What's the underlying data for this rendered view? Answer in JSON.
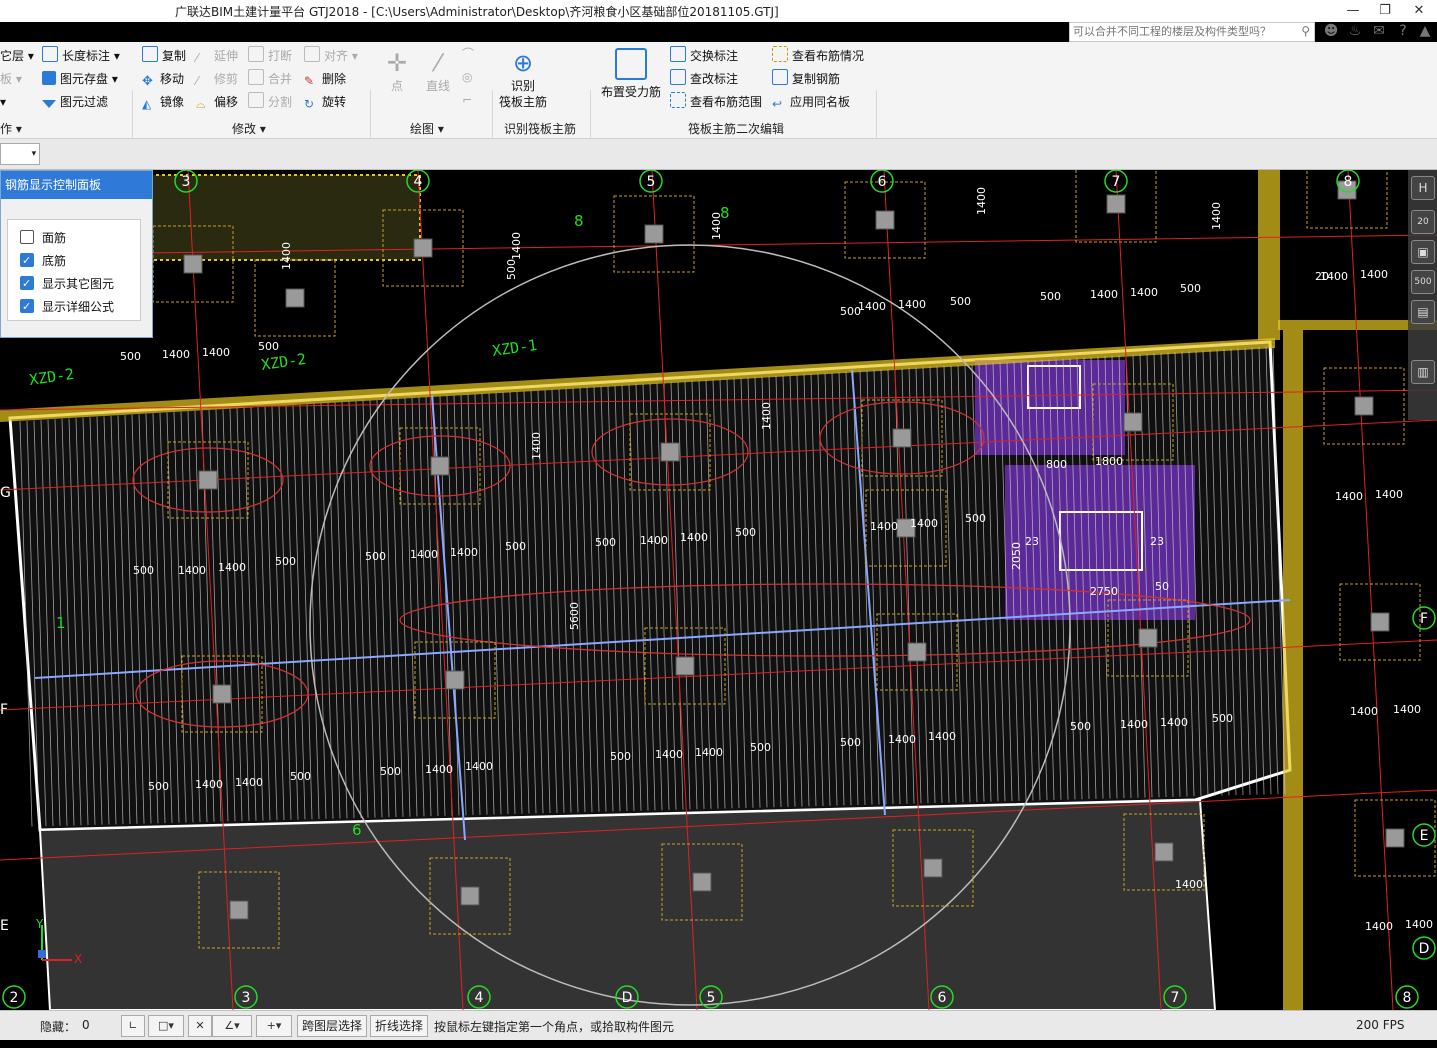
{
  "window": {
    "title": "广联达BIM土建计量平台 GTJ2018 - [C:\\Users\\Administrator\\Desktop\\齐河粮食小区基础部位20181105.GTJ]",
    "search_placeholder": "可以合并不同工程的楼层及构件类型吗？",
    "buttons": [
      "minimize",
      "restore",
      "close"
    ]
  },
  "ribbon": {
    "col1": [
      "它层",
      "板",
      "",
      "作"
    ],
    "col2": [
      "长度标注",
      "图元存盘",
      "图元过滤"
    ],
    "modify": [
      "复制",
      "移动",
      "镜像",
      "延伸",
      "修剪",
      "偏移",
      "打断",
      "合并",
      "分割",
      "对齐",
      "删除",
      "旋转"
    ],
    "modify_group": "修改",
    "draw": [
      "点",
      "直线"
    ],
    "draw_group": "绘图",
    "identify": {
      "line1": "识别",
      "line2": "筏板主筋",
      "group": "识别筏板主筋"
    },
    "edit_big": "布置受力筋",
    "edit": [
      "交换标注",
      "查改标注",
      "查看布筋范围",
      "查看布筋情况",
      "复制钢筋",
      "应用同名板"
    ],
    "edit_group": "筏板主筋二次编辑"
  },
  "panel": {
    "title": "钢筋显示控制面板",
    "options": [
      {
        "label": "面筋",
        "checked": false
      },
      {
        "label": "底筋",
        "checked": true
      },
      {
        "label": "显示其它图元",
        "checked": true
      },
      {
        "label": "显示详细公式",
        "checked": true
      }
    ]
  },
  "drawing": {
    "col_axes": [
      "3",
      "4",
      "5",
      "6",
      "7",
      "8"
    ],
    "bottom_axes": [
      "2",
      "3",
      "4",
      "D",
      "5",
      "6",
      "7",
      "8"
    ],
    "row_axes_left": [
      "G",
      "F",
      "E"
    ],
    "row_axes_right": [
      "F",
      "E",
      "D"
    ],
    "beam_labels": [
      "XZD-2",
      "XZD-2",
      "XZD-1"
    ],
    "dims": [
      "500",
      "1400",
      "1400",
      "500",
      "5600",
      "1800",
      "800",
      "2750",
      "2050",
      "50",
      "23",
      "23",
      "20"
    ],
    "grid_numbers": [
      "8",
      "8",
      "1",
      "6"
    ]
  },
  "navbar": [
    "H",
    "20",
    "500"
  ],
  "status": {
    "hidden_label": "隐藏：",
    "hidden_count": "0",
    "cross_layer": "跨图层选择",
    "polyline": "折线选择",
    "hint": "按鼠标左键指定第一个角点，或拾取构件图元",
    "fps": "200 FPS"
  },
  "colors": {
    "accent": "#2f7ad6",
    "grid_red": "#e02020",
    "dim_green": "#22dd22",
    "beam_yellow": "#e8c820",
    "slab_purple": "#7a3cc8"
  }
}
